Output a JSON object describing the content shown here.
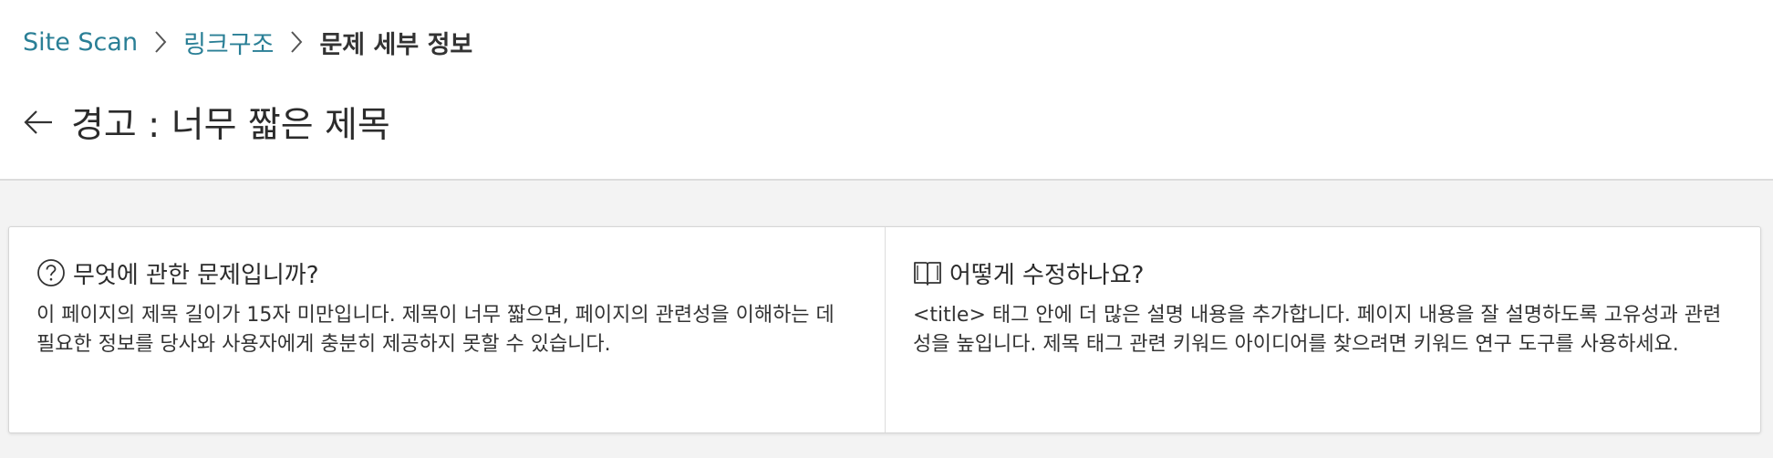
{
  "breadcrumb": {
    "items": [
      {
        "label": "Site Scan"
      },
      {
        "label": "링크구조"
      }
    ],
    "current": "문제 세부 정보"
  },
  "header": {
    "title": "경고 : 너무 짧은 제목"
  },
  "panels": {
    "what": {
      "title": "무엇에 관한 문제입니까?",
      "body": "이 페이지의 제목 길이가 15자 미만입니다. 제목이 너무 짧으면, 페이지의 관련성을 이해하는 데 필요한 정보를 당사와 사용자에게 충분히 제공하지 못할 수 있습니다."
    },
    "fix": {
      "title": "어떻게 수정하나요?",
      "body": "<title> 태그 안에 더 많은 설명 내용을 추가합니다. 페이지 내용을 잘 설명하도록 고유성과 관련성을 높입니다. 제목 태그 관련 키워드 아이디어를 찾으려면 키워드 연구 도구를 사용하세요."
    }
  },
  "icons": {
    "separator": "chevron-right-icon",
    "back": "arrow-left-icon",
    "what": "question-circle-icon",
    "fix": "book-open-icon"
  },
  "colors": {
    "link": "#2a7f96",
    "background": "#f3f3f3",
    "card": "#ffffff"
  }
}
